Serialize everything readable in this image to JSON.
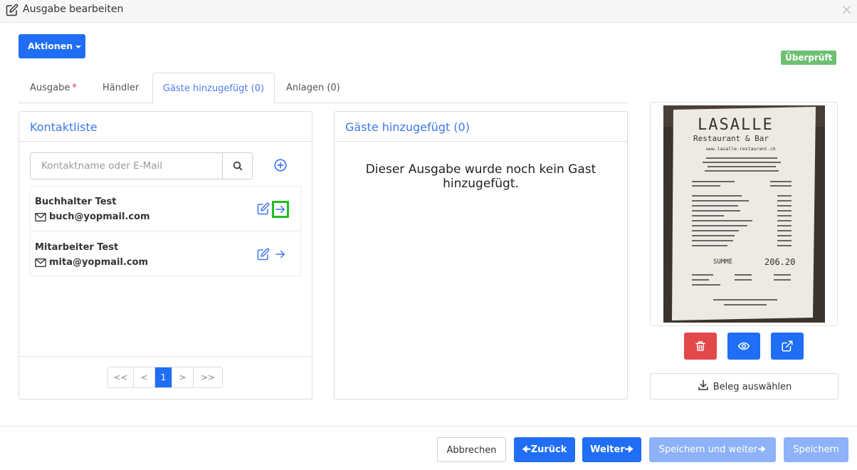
{
  "window": {
    "title": "Ausgabe bearbeiten"
  },
  "toolbar": {
    "actions_label": "Aktionen"
  },
  "status_badge": "Überprüft",
  "tabs": [
    {
      "label": "Ausgabe",
      "required": "*"
    },
    {
      "label": "Händler"
    },
    {
      "label": "Gäste hinzugefügt (0)"
    },
    {
      "label": "Anlagen (0)"
    }
  ],
  "contact_panel": {
    "title": "Kontaktliste",
    "search_placeholder": "Kontaktname oder E-Mail",
    "contacts": [
      {
        "name": "Buchhalter Test",
        "email": "buch@yopmail.com"
      },
      {
        "name": "Mitarbeiter Test",
        "email": "mita@yopmail.com"
      }
    ],
    "pagination": {
      "first": "<<",
      "prev": "<",
      "current": "1",
      "next": ">",
      "last": ">>"
    }
  },
  "guests_panel": {
    "title": "Gäste hinzugefügt (0)",
    "empty_message": "Dieser Ausgabe wurde noch kein Gast hinzugefügt."
  },
  "receipt": {
    "select_label": "Beleg auswählen"
  },
  "footer": {
    "cancel": "Abbrechen",
    "back": "Zurück",
    "next": "Weiter",
    "save_next": "Speichern und weiter",
    "save": "Speichern"
  },
  "colors": {
    "primary": "#1f6ef5",
    "danger": "#e2484a",
    "success": "#6cc070",
    "highlight": "#21c021"
  }
}
